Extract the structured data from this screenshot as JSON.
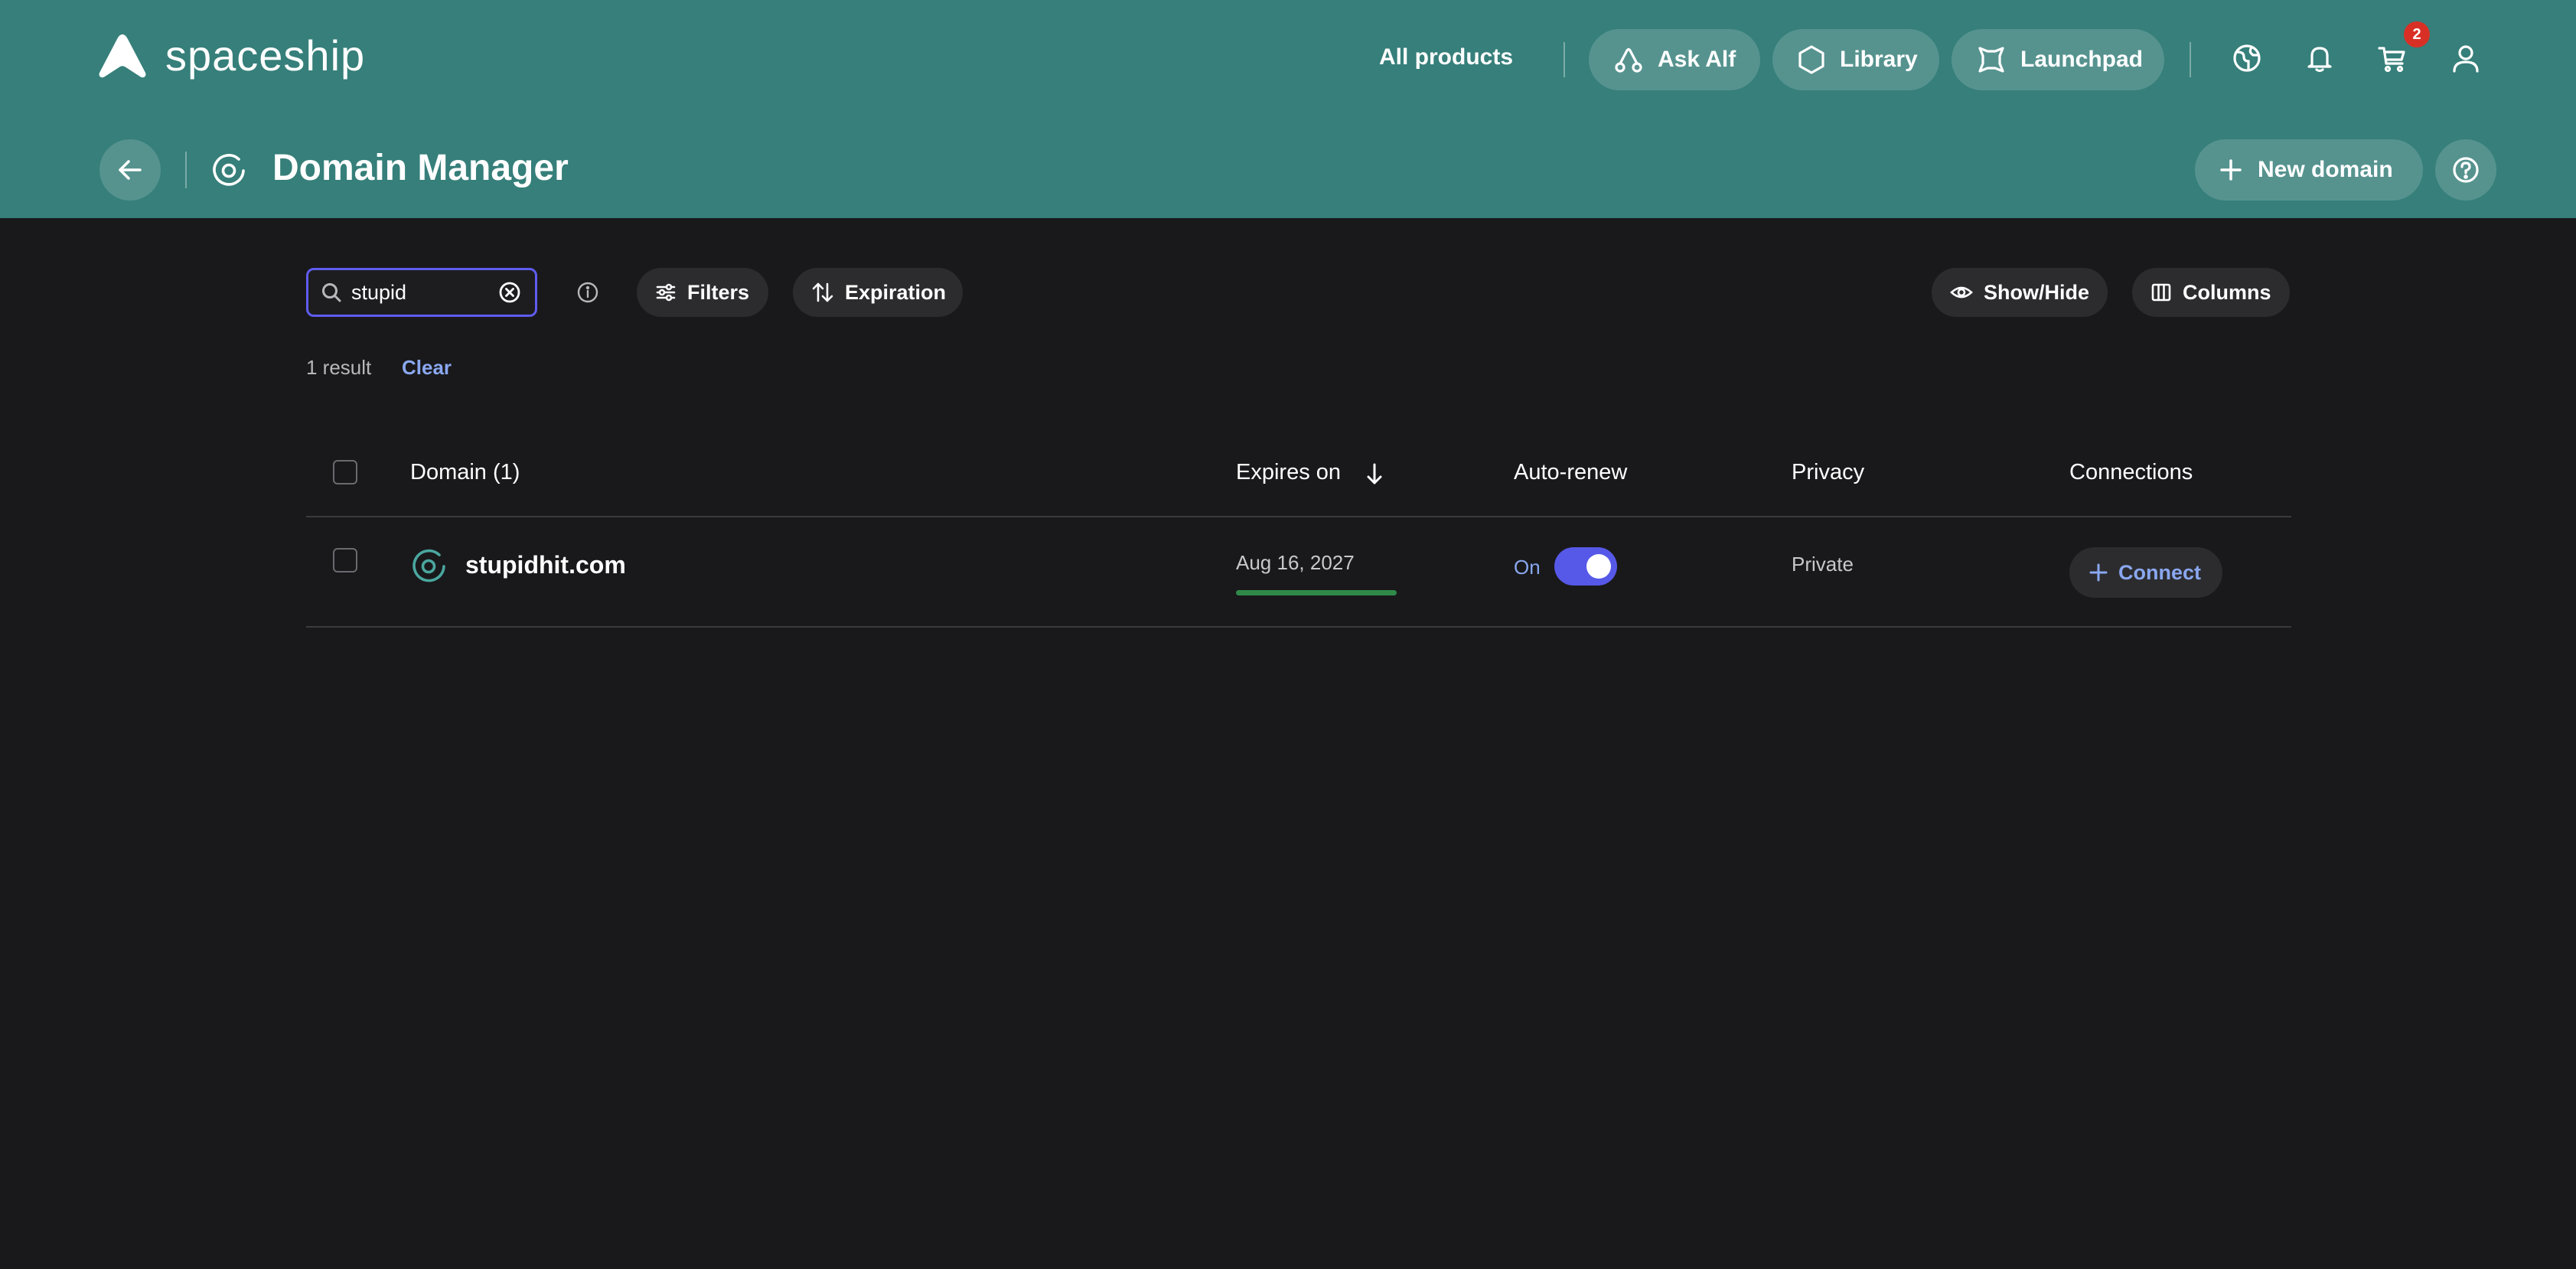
{
  "header": {
    "brand": "spaceship",
    "all_products": "All products",
    "nav": [
      {
        "label": "Ask Alf",
        "icon": "alf-icon"
      },
      {
        "label": "Library",
        "icon": "hexagon-icon"
      },
      {
        "label": "Launchpad",
        "icon": "launchpad-icon"
      }
    ],
    "cart_count": "2",
    "page_title": "Domain Manager",
    "new_domain_label": "New domain"
  },
  "toolbar": {
    "search_value": "stupid",
    "filters_label": "Filters",
    "sort_label": "Expiration",
    "show_hide_label": "Show/Hide",
    "columns_label": "Columns"
  },
  "results": {
    "count_text": "1 result",
    "clear_label": "Clear"
  },
  "table": {
    "columns": [
      "Domain (1)",
      "Expires on",
      "Auto-renew",
      "Privacy",
      "Connections"
    ],
    "rows": [
      {
        "domain": "stupidhit.com",
        "expires": "Aug 16, 2027",
        "auto_renew": "On",
        "privacy": "Private",
        "connect_label": "Connect"
      }
    ]
  },
  "colors": {
    "header_bg": "#367f7a",
    "page_bg": "#19191b",
    "accent": "#5659e8",
    "link": "#8aa8f0",
    "badge": "#d93025",
    "expiry_bar": "#2f8a4a"
  }
}
